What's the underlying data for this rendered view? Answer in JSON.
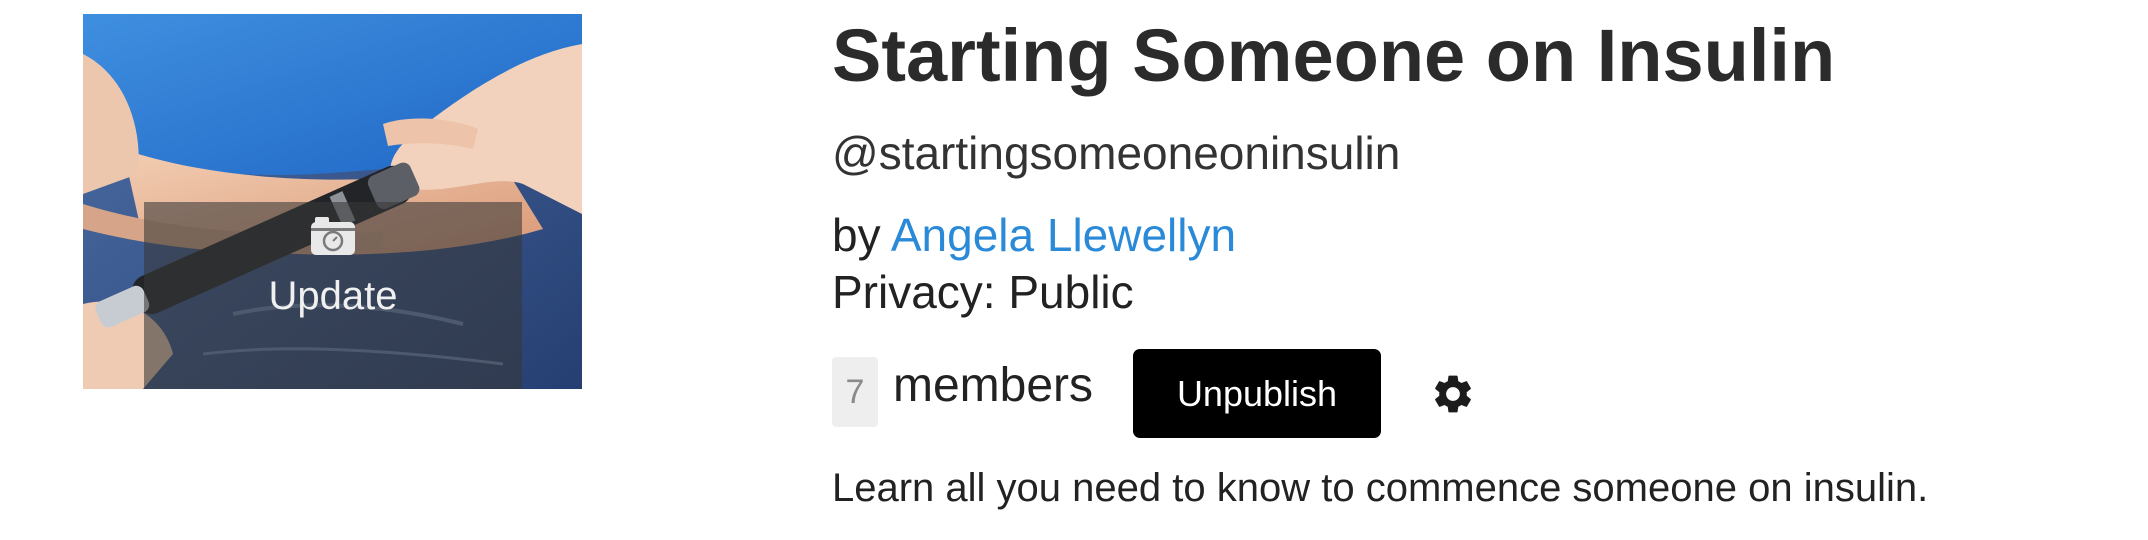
{
  "group": {
    "title": "Starting Someone on Insulin",
    "handle": "@startingsomeoneoninsulin",
    "by_prefix": "by",
    "author": "Angela Llewellyn",
    "privacy": "Privacy: Public",
    "member_count": "7",
    "members_label": "members",
    "description": "Learn all you need to know to commence someone on insulin."
  },
  "cover": {
    "update_label": "Update",
    "camera_icon": "camera-icon",
    "image_subject": "insulin pen injection"
  },
  "actions": {
    "unpublish_label": "Unpublish",
    "settings_icon": "gear-icon"
  },
  "colors": {
    "link": "#2a8ad8",
    "button_bg": "#000000",
    "button_text": "#ffffff",
    "count_badge_bg": "#eeeeee"
  }
}
